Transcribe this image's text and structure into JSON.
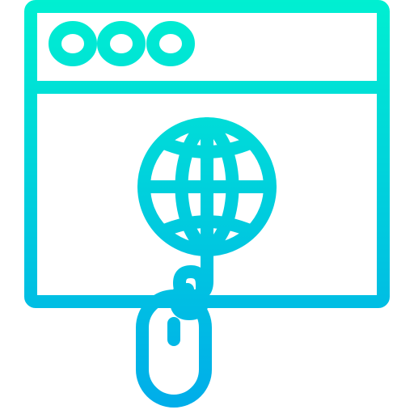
{
  "icon": {
    "name": "web-browser-globe-mouse-icon",
    "style": "outline",
    "gradient": {
      "top_color": "#00EFD1",
      "bottom_color": "#00ACEA"
    },
    "window_control_dots": 3
  }
}
